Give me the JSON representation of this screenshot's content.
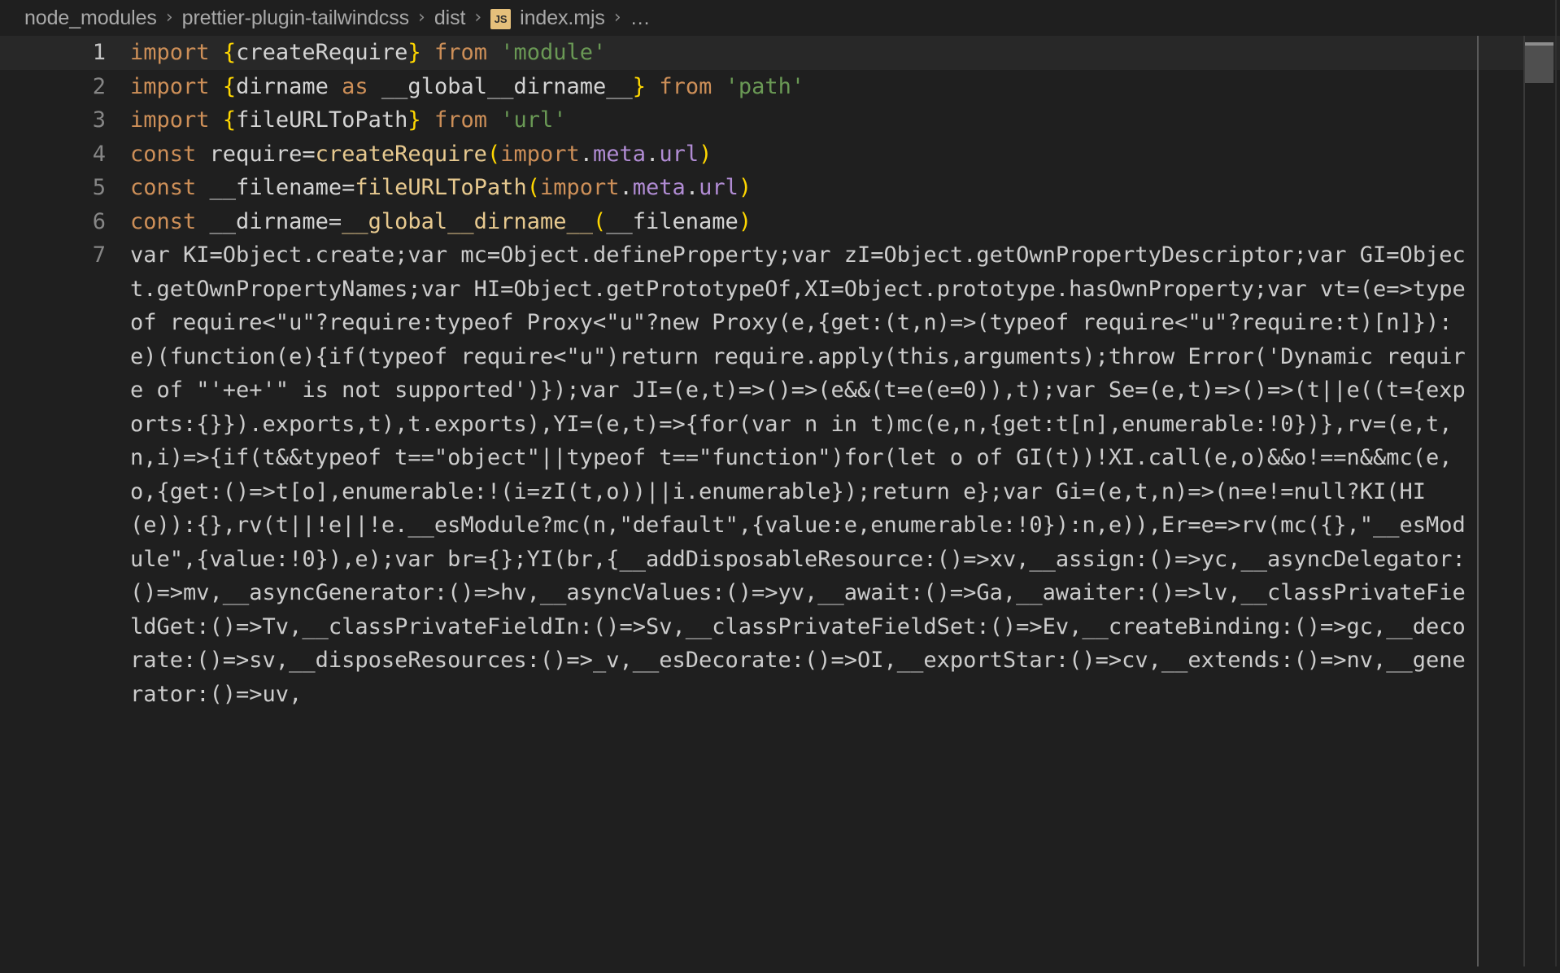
{
  "window": {
    "background": "#1f1f1f",
    "editor_background": "#1f1f1f",
    "current_line_background": "#282828"
  },
  "breadcrumb": {
    "items": [
      {
        "label": "node_modules",
        "icon": null
      },
      {
        "label": "prettier-plugin-tailwindcss",
        "icon": null
      },
      {
        "label": "dist",
        "icon": null
      },
      {
        "label": "index.mjs",
        "icon": "js-file-icon",
        "icon_text": "JS"
      },
      {
        "label": "…",
        "icon": null
      }
    ],
    "separator": "›"
  },
  "colors": {
    "keyword": "#cd8f58",
    "string": "#6a9955",
    "brace": "#ffd700",
    "function": "#e7c98f",
    "property": "#b18cd4",
    "plain_text": "#cccccc",
    "line_number": "#868686",
    "line_number_active": "#c6c6c6",
    "js_icon_background": "#e5c07b",
    "scrollbar_thumb": "#4f4f4f"
  },
  "editor": {
    "language": "javascript",
    "file_name": "index.mjs",
    "current_line": 1,
    "lines": [
      {
        "number": "1",
        "current": true,
        "tokens": [
          {
            "t": "import",
            "c": "kw"
          },
          {
            "t": " ",
            "c": "plain"
          },
          {
            "t": "{",
            "c": "brace"
          },
          {
            "t": "createRequire",
            "c": "var"
          },
          {
            "t": "}",
            "c": "brace"
          },
          {
            "t": " ",
            "c": "plain"
          },
          {
            "t": "from",
            "c": "kw"
          },
          {
            "t": " ",
            "c": "plain"
          },
          {
            "t": "'module'",
            "c": "str"
          }
        ]
      },
      {
        "number": "2",
        "current": false,
        "tokens": [
          {
            "t": "import",
            "c": "kw"
          },
          {
            "t": " ",
            "c": "plain"
          },
          {
            "t": "{",
            "c": "brace"
          },
          {
            "t": "dirname",
            "c": "var"
          },
          {
            "t": " ",
            "c": "plain"
          },
          {
            "t": "as",
            "c": "kw"
          },
          {
            "t": " ",
            "c": "plain"
          },
          {
            "t": "__global__dirname__",
            "c": "var"
          },
          {
            "t": "}",
            "c": "brace"
          },
          {
            "t": " ",
            "c": "plain"
          },
          {
            "t": "from",
            "c": "kw"
          },
          {
            "t": " ",
            "c": "plain"
          },
          {
            "t": "'path'",
            "c": "str"
          }
        ]
      },
      {
        "number": "3",
        "current": false,
        "tokens": [
          {
            "t": "import",
            "c": "kw"
          },
          {
            "t": " ",
            "c": "plain"
          },
          {
            "t": "{",
            "c": "brace"
          },
          {
            "t": "fileURLToPath",
            "c": "var"
          },
          {
            "t": "}",
            "c": "brace"
          },
          {
            "t": " ",
            "c": "plain"
          },
          {
            "t": "from",
            "c": "kw"
          },
          {
            "t": " ",
            "c": "plain"
          },
          {
            "t": "'url'",
            "c": "str"
          }
        ]
      },
      {
        "number": "4",
        "current": false,
        "tokens": [
          {
            "t": "const",
            "c": "kw"
          },
          {
            "t": " ",
            "c": "plain"
          },
          {
            "t": "require",
            "c": "var"
          },
          {
            "t": "=",
            "c": "punc"
          },
          {
            "t": "createRequire",
            "c": "fn"
          },
          {
            "t": "(",
            "c": "brace"
          },
          {
            "t": "import",
            "c": "kw"
          },
          {
            "t": ".",
            "c": "punc"
          },
          {
            "t": "meta",
            "c": "prop"
          },
          {
            "t": ".",
            "c": "punc"
          },
          {
            "t": "url",
            "c": "prop"
          },
          {
            "t": ")",
            "c": "brace"
          }
        ]
      },
      {
        "number": "5",
        "current": false,
        "tokens": [
          {
            "t": "const",
            "c": "kw"
          },
          {
            "t": " ",
            "c": "plain"
          },
          {
            "t": "__filename",
            "c": "var"
          },
          {
            "t": "=",
            "c": "punc"
          },
          {
            "t": "fileURLToPath",
            "c": "fn"
          },
          {
            "t": "(",
            "c": "brace"
          },
          {
            "t": "import",
            "c": "kw"
          },
          {
            "t": ".",
            "c": "punc"
          },
          {
            "t": "meta",
            "c": "prop"
          },
          {
            "t": ".",
            "c": "punc"
          },
          {
            "t": "url",
            "c": "prop"
          },
          {
            "t": ")",
            "c": "brace"
          }
        ]
      },
      {
        "number": "6",
        "current": false,
        "tokens": [
          {
            "t": "const",
            "c": "kw"
          },
          {
            "t": " ",
            "c": "plain"
          },
          {
            "t": "__dirname",
            "c": "var"
          },
          {
            "t": "=",
            "c": "punc"
          },
          {
            "t": "__global__dirname__",
            "c": "fn"
          },
          {
            "t": "(",
            "c": "brace"
          },
          {
            "t": "__filename",
            "c": "var"
          },
          {
            "t": ")",
            "c": "brace"
          }
        ]
      },
      {
        "number": "7",
        "current": false,
        "wrapped": true,
        "text": "var KI=Object.create;var mc=Object.defineProperty;var zI=Object.getOwnPropertyDescriptor;var GI=Object.getOwnPropertyNames;var HI=Object.getPrototypeOf,XI=Object.prototype.hasOwnProperty;var vt=(e=>typeof require<\"u\"?require:typeof Proxy<\"u\"?new Proxy(e,{get:(t,n)=>(typeof require<\"u\"?require:t)[n]}):e)(function(e){if(typeof require<\"u\")return require.apply(this,arguments);throw Error('Dynamic require of \"'+e+'\" is not supported')});var JI=(e,t)=>()=>(e&&(t=e(e=0)),t);var Se=(e,t)=>()=>(t||e((t={exports:{}}).exports,t),t.exports),YI=(e,t)=>{for(var n in t)mc(e,n,{get:t[n],enumerable:!0})},rv=(e,t,n,i)=>{if(t&&typeof t==\"object\"||typeof t==\"function\")for(let o of GI(t))!XI.call(e,o)&&o!==n&&mc(e,o,{get:()=>t[o],enumerable:!(i=zI(t,o))||i.enumerable});return e};var Gi=(e,t,n)=>(n=e!=null?KI(HI(e)):{},rv(t||!e||!e.__esModule?mc(n,\"default\",{value:e,enumerable:!0}):n,e)),Er=e=>rv(mc({},\"__esModule\",{value:!0}),e);var br={};YI(br,{__addDisposableResource:()=>xv,__assign:()=>yc,__asyncDelegator:()=>mv,__asyncGenerator:()=>hv,__asyncValues:()=>yv,__await:()=>Ga,__awaiter:()=>lv,__classPrivateFieldGet:()=>Tv,__classPrivateFieldIn:()=>Sv,__classPrivateFieldSet:()=>Ev,__createBinding:()=>gc,__decorate:()=>sv,__disposeResources:()=>_v,__esDecorate:()=>OI,__exportStar:()=>cv,__extends:()=>nv,__generator:()=>uv,"
      }
    ]
  },
  "scrollbar": {
    "name": "vertical-scrollbar",
    "thumb_top_percent": 0.7,
    "thumb_height_percent": 4.3
  }
}
